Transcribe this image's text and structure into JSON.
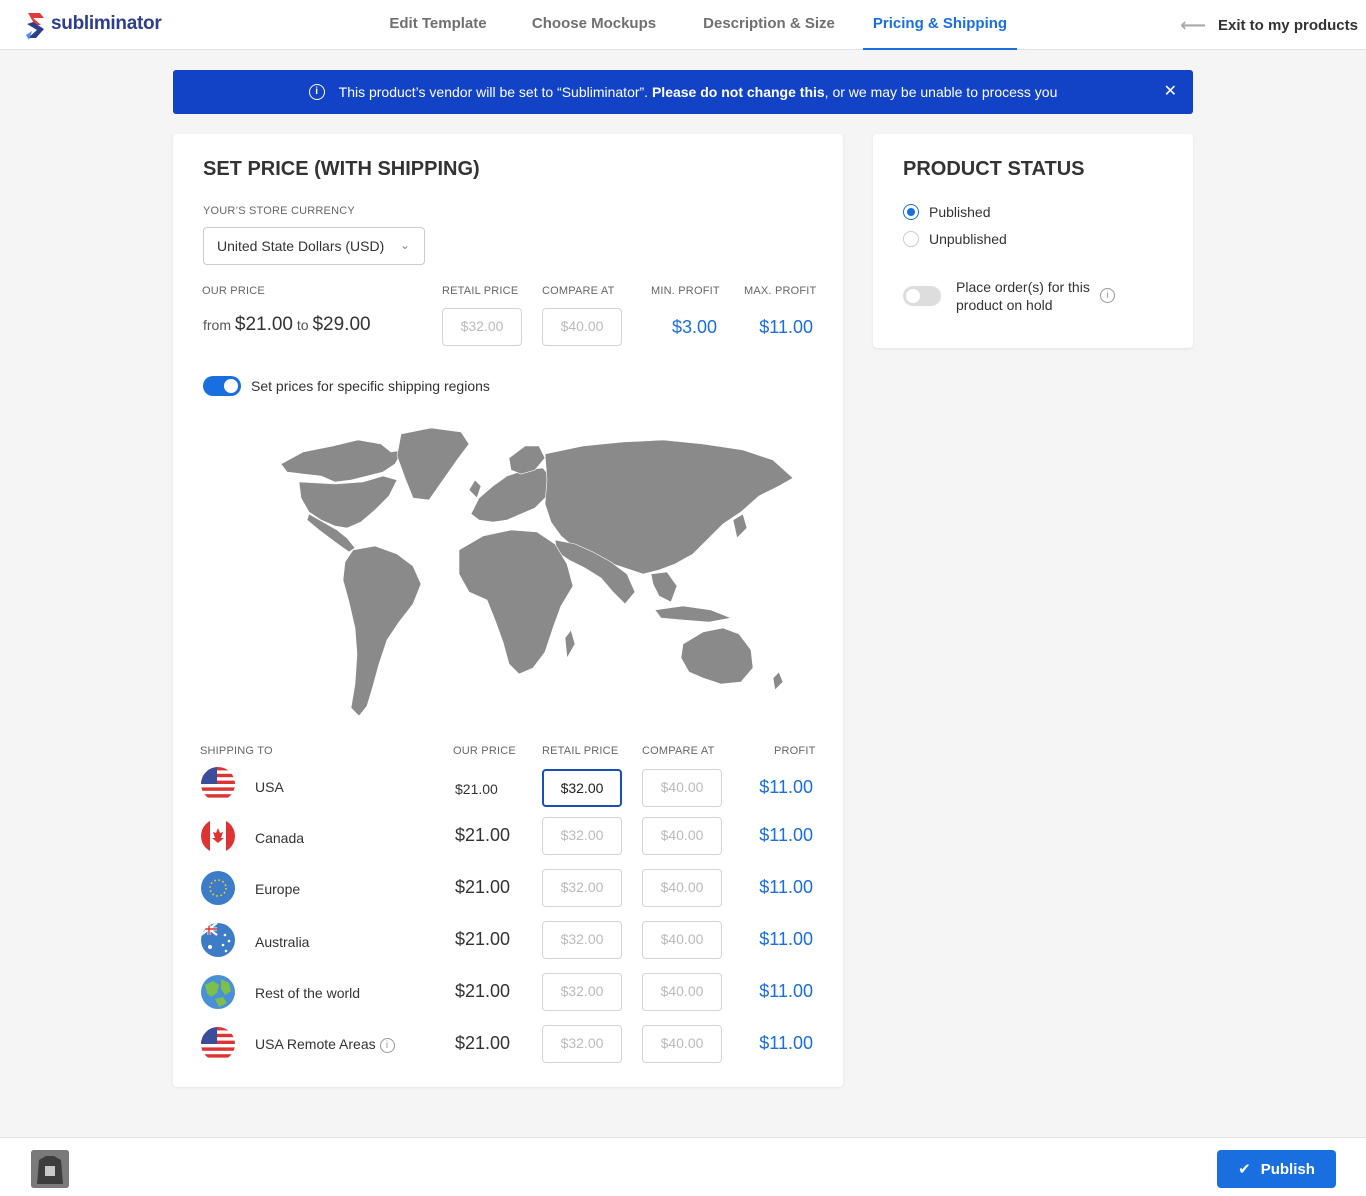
{
  "brand": {
    "name": "subliminator"
  },
  "nav": {
    "tabs": [
      {
        "label": "Edit Template"
      },
      {
        "label": "Choose Mockups"
      },
      {
        "label": "Description & Size"
      },
      {
        "label": "Pricing & Shipping",
        "active": true
      }
    ],
    "exit_label": "Exit to my products"
  },
  "banner": {
    "text_before": "This product’s vendor will be set to “Subliminator”. ",
    "text_bold": "Please do not change this",
    "text_after": ", or we may be unable to process you"
  },
  "pricing": {
    "title": "SET PRICE (WITH SHIPPING)",
    "currency_label": "YOUR’S STORE CURRENCY",
    "currency_value": "United State Dollars (USD)",
    "headers": {
      "our_price": "OUR PRICE",
      "retail_price": "RETAIL PRICE",
      "compare_at": "COMPARE AT",
      "min_profit": "MIN. PROFIT",
      "max_profit": "MAX. PROFIT"
    },
    "our_price": {
      "from_word": "from",
      "min": "$21.00",
      "to_word": "to",
      "max": "$29.00"
    },
    "retail_placeholder": "$32.00",
    "compare_placeholder": "$40.00",
    "min_profit": "$3.00",
    "max_profit": "$11.00",
    "regions_toggle_label": "Set prices for specific shipping regions",
    "table_headers": {
      "shipping_to": "SHIPPING TO",
      "our_price": "OUR PRICE",
      "retail_price": "RETAIL PRICE",
      "compare_at": "COMPARE AT",
      "profit": "PROFIT"
    },
    "rows": [
      {
        "region": "USA",
        "our_price": "$21.00",
        "retail": "$32.00",
        "compare": "$40.00",
        "profit": "$11.00",
        "flag": "usa-flag-icon"
      },
      {
        "region": "Canada",
        "our_price": "$21.00",
        "retail": "$32.00",
        "compare": "$40.00",
        "profit": "$11.00",
        "flag": "canada-flag-icon"
      },
      {
        "region": "Europe",
        "our_price": "$21.00",
        "retail": "$32.00",
        "compare": "$40.00",
        "profit": "$11.00",
        "flag": "eu-flag-icon"
      },
      {
        "region": "Australia",
        "our_price": "$21.00",
        "retail": "$32.00",
        "compare": "$40.00",
        "profit": "$11.00",
        "flag": "australia-flag-icon"
      },
      {
        "region": "Rest of the world",
        "our_price": "$21.00",
        "retail": "$32.00",
        "compare": "$40.00",
        "profit": "$11.00",
        "flag": "globe-icon"
      },
      {
        "region": "USA Remote Areas",
        "our_price": "$21.00",
        "retail": "$32.00",
        "compare": "$40.00",
        "profit": "$11.00",
        "flag": "usa-flag-icon"
      }
    ]
  },
  "status": {
    "title": "PRODUCT STATUS",
    "options": [
      {
        "label": "Published",
        "checked": true
      },
      {
        "label": "Unpublished",
        "checked": false
      }
    ],
    "hold_label_line1": "Place order(s) for this",
    "hold_label_line2": "product on hold"
  },
  "footer": {
    "publish_label": "Publish"
  },
  "colors": {
    "accent": "#1a6fe0",
    "banner": "#1243c7",
    "map": "#8a8a8a"
  }
}
